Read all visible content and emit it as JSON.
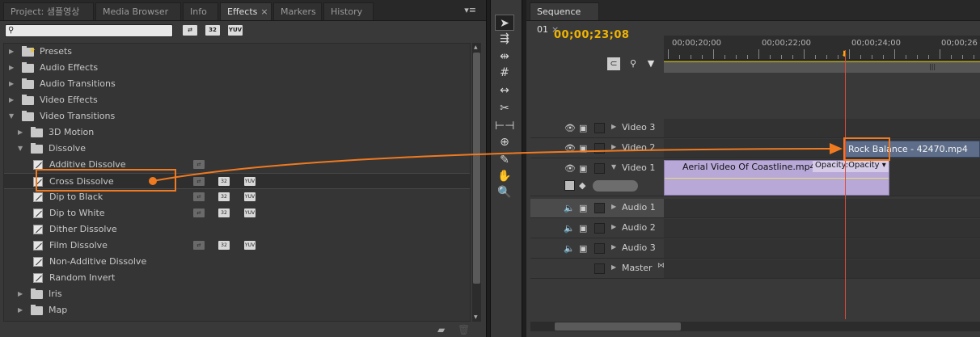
{
  "effects_panel": {
    "tabs": [
      "Project: 샘플영상",
      "Media Browser",
      "Info",
      "Effects",
      "Markers",
      "History"
    ],
    "active_tab": "Effects",
    "tab_close": "×",
    "menu_glyph": "▾≡",
    "search": {
      "value": "",
      "placeholder": ""
    },
    "filter_buttons": [
      "⇄",
      "32",
      "YUV"
    ],
    "tree": [
      {
        "label": "Presets",
        "type": "folder-presets",
        "level": 0,
        "expanded": false
      },
      {
        "label": "Audio Effects",
        "type": "folder",
        "level": 0,
        "expanded": false
      },
      {
        "label": "Audio Transitions",
        "type": "folder",
        "level": 0,
        "expanded": false
      },
      {
        "label": "Video Effects",
        "type": "folder",
        "level": 0,
        "expanded": false
      },
      {
        "label": "Video Transitions",
        "type": "folder",
        "level": 0,
        "expanded": true
      },
      {
        "label": "3D Motion",
        "type": "folder",
        "level": 1,
        "expanded": false
      },
      {
        "label": "Dissolve",
        "type": "folder",
        "level": 1,
        "expanded": true
      },
      {
        "label": "Additive Dissolve",
        "type": "effect",
        "level": 2,
        "badges": [
          "dim",
          "",
          ""
        ]
      },
      {
        "label": "Cross Dissolve",
        "type": "effect",
        "level": 2,
        "selected": true,
        "badges": [
          "dim",
          "on",
          "on"
        ]
      },
      {
        "label": "Dip to Black",
        "type": "effect",
        "level": 2,
        "badges": [
          "dim",
          "on",
          "on"
        ]
      },
      {
        "label": "Dip to White",
        "type": "effect",
        "level": 2,
        "badges": [
          "dim",
          "on",
          "on"
        ]
      },
      {
        "label": "Dither Dissolve",
        "type": "effect",
        "level": 2,
        "badges": []
      },
      {
        "label": "Film Dissolve",
        "type": "effect",
        "level": 2,
        "badges": [
          "dim",
          "on",
          "on"
        ]
      },
      {
        "label": "Non-Additive Dissolve",
        "type": "effect",
        "level": 2,
        "badges": []
      },
      {
        "label": "Random Invert",
        "type": "effect",
        "level": 2,
        "badges": []
      },
      {
        "label": "Iris",
        "type": "folder",
        "level": 1,
        "expanded": false
      },
      {
        "label": "Map",
        "type": "folder",
        "level": 1,
        "expanded": false
      }
    ],
    "badge_text": [
      "⇄",
      "32",
      "YUV"
    ]
  },
  "tools": [
    "selection-tool",
    "track-select-tool",
    "ripple-edit-tool",
    "rolling-edit-tool",
    "rate-stretch-tool",
    "razor-tool",
    "slip-tool",
    "slide-tool",
    "pen-tool",
    "hand-tool",
    "zoom-tool"
  ],
  "tool_glyphs": [
    "➤",
    "⇶",
    "⇹",
    "#",
    "↔",
    "✂",
    "⊢⊣",
    "⊕",
    "✎",
    "✋",
    "🔍"
  ],
  "sequence": {
    "tab": "Sequence 01",
    "tab_close": "×",
    "timecode": "00;00;23;08",
    "ruler_labels": [
      "00;00;20;00",
      "00;00;22;00",
      "00;00;24;00",
      "00;00;26"
    ],
    "tracks": [
      {
        "name": "Video 3",
        "kind": "video",
        "expanded": false
      },
      {
        "name": "Video 2",
        "kind": "video",
        "expanded": false
      },
      {
        "name": "Video 1",
        "kind": "video",
        "expanded": true
      },
      {
        "name": "Audio 1",
        "kind": "audio",
        "highlight": true
      },
      {
        "name": "Audio 2",
        "kind": "audio"
      },
      {
        "name": "Audio 3",
        "kind": "audio"
      },
      {
        "name": "Master",
        "kind": "master"
      }
    ],
    "clips": {
      "video2": "Rock Balance - 42470.mp4",
      "video1": "Aerial Video Of Coastline.mp4",
      "video1_opacity": "Opacity:Opacity ▾"
    },
    "colors": {
      "timecode": "#f0b400",
      "playhead": "#e04a3a",
      "annotation": "#f07a20",
      "video1_clip": "#b8a8d8",
      "video2_clip": "#5e6e8a"
    }
  }
}
